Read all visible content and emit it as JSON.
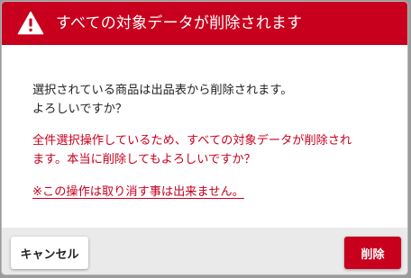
{
  "dialog": {
    "title": "すべての対象データが削除されます",
    "icon": "warning-triangle-icon",
    "message_line1": "選択されている商品は出品表から削除されます。",
    "message_line2": "よろしいですか？",
    "warning_line1": "全件選択操作しているため、すべての対象データが削除され",
    "warning_line2": "ます。本当に削除してもよろしいですか？",
    "note": "※この操作は取り消す事は出来ません。",
    "cancel_label": "キャンセル",
    "delete_label": "削除"
  },
  "colors": {
    "accent": "#c8001e",
    "footer_bg": "#eaeaea",
    "text": "#222222"
  }
}
